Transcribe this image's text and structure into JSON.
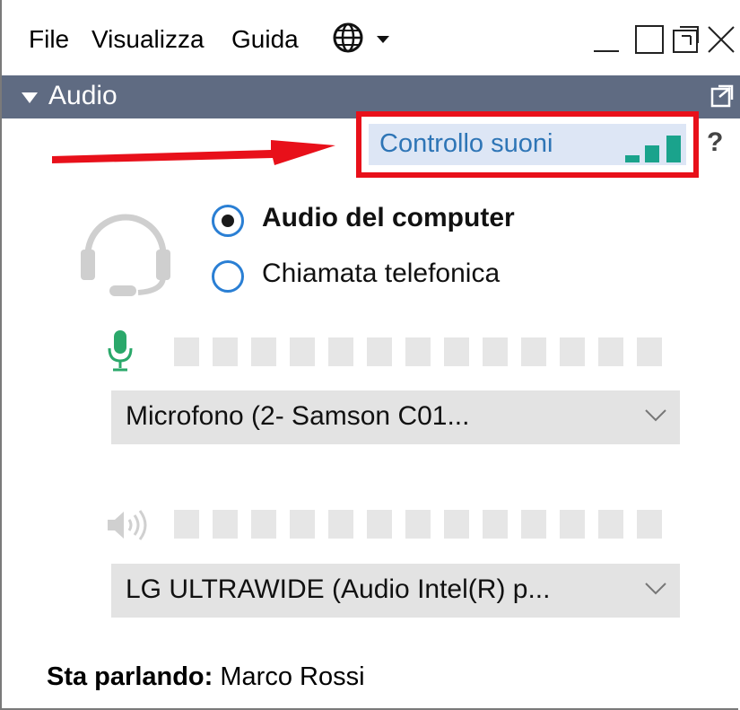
{
  "menu": {
    "items": [
      "File",
      "Visualizza",
      "Guida"
    ],
    "globe_icon": "globe-icon"
  },
  "window_controls": [
    "minimize-icon",
    "maximize-icon",
    "restore-icon",
    "close-icon"
  ],
  "section": {
    "title": "Audio",
    "popout_icon": "popout-icon"
  },
  "sound_control": {
    "label": "Controllo suoni",
    "icon": "signal-bars-icon",
    "help": "?",
    "highlight_color": "#e8101a",
    "arrow_color": "#e8101a"
  },
  "audio_options": [
    {
      "label": "Audio del computer",
      "selected": true
    },
    {
      "label": "Chiamata telefonica",
      "selected": false
    }
  ],
  "microphone": {
    "icon": "microphone-icon",
    "icon_color": "#2aa86a",
    "level": 0,
    "segments": 13,
    "device": "Microfono (2- Samson C01..."
  },
  "speaker": {
    "icon": "speaker-icon",
    "level": 0,
    "segments": 13,
    "device": "LG ULTRAWIDE (Audio Intel(R) p..."
  },
  "speaking": {
    "label": "Sta parlando:",
    "name": "Marco Rossi"
  },
  "colors": {
    "header_bg": "#5f6b82",
    "accent": "#2a7fd4",
    "sound_label": "#2e75b6",
    "bars": "#1aa38c"
  }
}
